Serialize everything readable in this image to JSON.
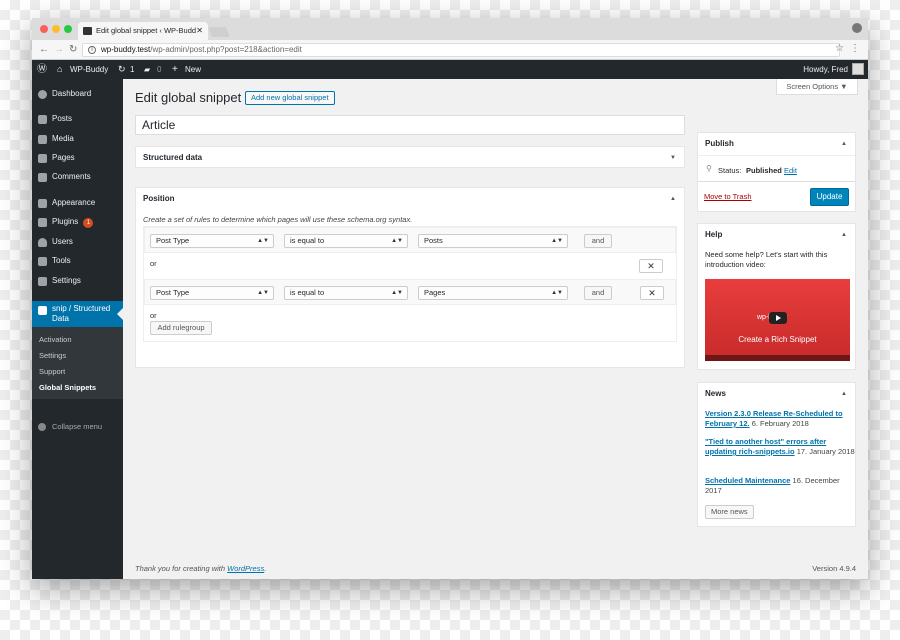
{
  "browser": {
    "tab_title": "Edit global snippet ‹ WP-Budd",
    "url_host": "wp-buddy.test",
    "url_path": "/wp-admin/post.php?post=218&action=edit"
  },
  "adminbar": {
    "site_name": "WP-Buddy",
    "updates": "1",
    "comments": "0",
    "new": "New",
    "howdy": "Howdy, Fred"
  },
  "sidebar": {
    "items": [
      {
        "label": "Dashboard"
      },
      {
        "label": "Posts"
      },
      {
        "label": "Media"
      },
      {
        "label": "Pages"
      },
      {
        "label": "Comments"
      },
      {
        "label": "Appearance"
      },
      {
        "label": "Plugins",
        "badge": "1"
      },
      {
        "label": "Users"
      },
      {
        "label": "Tools"
      },
      {
        "label": "Settings"
      }
    ],
    "active_line1": "snip / Structured",
    "active_line2": "Data",
    "submenu": [
      "Activation",
      "Settings",
      "Support",
      "Global Snippets"
    ],
    "collapse": "Collapse menu"
  },
  "page": {
    "title": "Edit global snippet",
    "add_new": "Add new global snippet",
    "screen_options": "Screen Options ▼",
    "post_title": "Article"
  },
  "structured_box": {
    "title": "Structured data"
  },
  "position_box": {
    "title": "Position",
    "description": "Create a set of rules to determine which pages will use these schema.org syntax.",
    "rules": [
      {
        "param": "Post Type",
        "operator": "is equal to",
        "value": "Posts",
        "and": "and"
      },
      {
        "param": "Post Type",
        "operator": "is equal to",
        "value": "Pages",
        "and": "and"
      }
    ],
    "or": "or",
    "add_rulegroup": "Add rulegroup"
  },
  "publish": {
    "title": "Publish",
    "status_label": "Status:",
    "status_value": "Published",
    "edit": "Edit",
    "trash": "Move to Trash",
    "update": "Update"
  },
  "help": {
    "title": "Help",
    "text": "Need some help? Let's start with this introduction video:",
    "video_title": "Create a Rich Snippet",
    "video_brand": "wp-buddy"
  },
  "news": {
    "title": "News",
    "items": [
      {
        "link": "Version 2.3.0 Release Re-Scheduled to February 12.",
        "date": "6. February 2018"
      },
      {
        "link": "\"Tied to another host\" errors after updating rich-snippets.io",
        "date": "17. January 2018"
      },
      {
        "link": "Scheduled Maintenance",
        "date": "16. December 2017"
      }
    ],
    "more": "More news"
  },
  "footer": {
    "thanks": "Thank you for creating with ",
    "wp": "WordPress",
    "dot": ".",
    "version": "Version 4.9.4"
  },
  "colors": {
    "admin_bar": "#23282d",
    "accent": "#0073aa",
    "update_button": "#0085ba",
    "trash": "#aa0000",
    "badge": "#d54e21"
  }
}
